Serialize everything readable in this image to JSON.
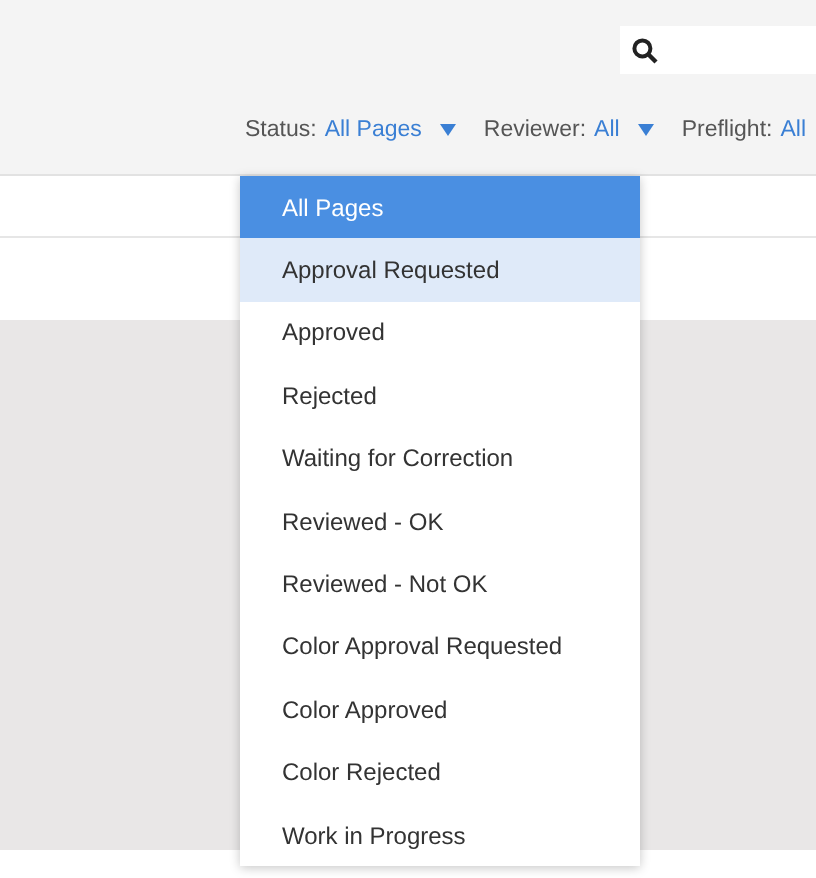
{
  "filters": [
    {
      "label": "Status:",
      "value": "All Pages",
      "has_caret": true
    },
    {
      "label": "Reviewer:",
      "value": "All",
      "has_caret": true
    },
    {
      "label": "Preflight:",
      "value": "All",
      "has_caret": false
    }
  ],
  "status_menu": {
    "items": [
      {
        "label": "All Pages",
        "selected": true,
        "highlighted": false
      },
      {
        "label": "Approval Requested",
        "selected": false,
        "highlighted": true
      },
      {
        "label": "Approved",
        "selected": false,
        "highlighted": false
      },
      {
        "label": "Rejected",
        "selected": false,
        "highlighted": false
      },
      {
        "label": "Waiting for Correction",
        "selected": false,
        "highlighted": false
      },
      {
        "label": "Reviewed - OK",
        "selected": false,
        "highlighted": false
      },
      {
        "label": "Reviewed - Not OK",
        "selected": false,
        "highlighted": false
      },
      {
        "label": "Color Approval Requested",
        "selected": false,
        "highlighted": false
      },
      {
        "label": "Color Approved",
        "selected": false,
        "highlighted": false
      },
      {
        "label": "Color Rejected",
        "selected": false,
        "highlighted": false
      },
      {
        "label": "Work in Progress",
        "selected": false,
        "highlighted": false
      }
    ]
  }
}
